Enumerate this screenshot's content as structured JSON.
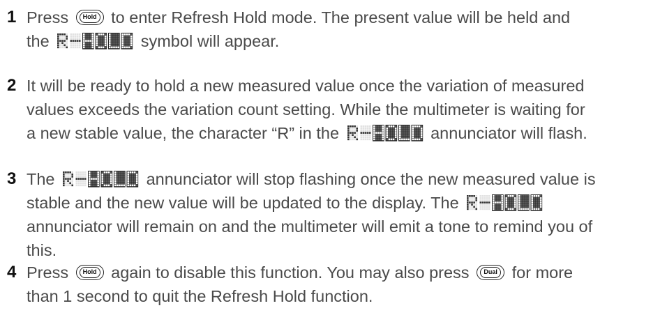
{
  "steps": [
    {
      "number": "1",
      "lines": [
        [
          "Press",
          {
            "key": "Hold"
          },
          "to enter Refresh Hold mode. The present value will be held and"
        ],
        [
          "the",
          {
            "annunciator": "R-HOLD"
          },
          "symbol will appear."
        ]
      ]
    },
    {
      "number": "2",
      "lines": [
        [
          "It will be ready to hold a new measured value once the variation of measured"
        ],
        [
          "values exceeds the variation count setting. While the multimeter is waiting for"
        ],
        [
          "a new stable value, the character “R” in the",
          {
            "annunciator": "R-HOLD"
          },
          "annunciator will flash."
        ]
      ]
    },
    {
      "number": "3",
      "lines": [
        [
          "The",
          {
            "annunciator": "R-HOLD"
          },
          "annunciator will stop flashing once the new measured value is"
        ],
        [
          "stable and the new value will be updated to the display. The",
          {
            "annunciator": "R-HOLD"
          }
        ],
        [
          "annunciator will remain on and the multimeter will emit a tone to remind you of"
        ],
        [
          "this."
        ]
      ]
    },
    {
      "number": "4",
      "lines": [
        [
          "Press",
          {
            "key": "Hold"
          },
          "again to disable this function. You may also press",
          {
            "key": "Dual"
          },
          "for more"
        ],
        [
          "than 1 second to quit the Refresh Hold function."
        ]
      ]
    }
  ]
}
